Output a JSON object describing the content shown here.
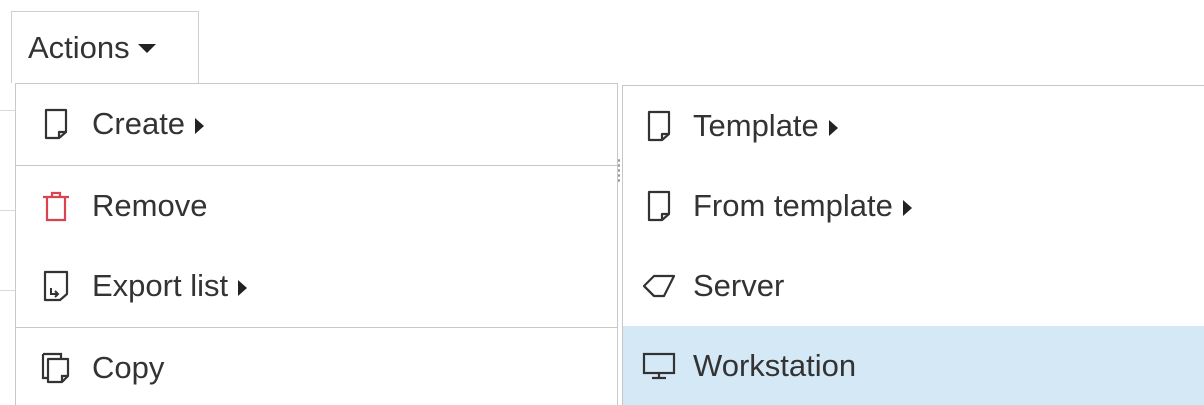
{
  "actions_button": {
    "label": "Actions"
  },
  "menu": {
    "items": [
      {
        "label": "Create",
        "icon": "document-icon",
        "has_submenu": true
      },
      {
        "label": "Remove",
        "icon": "trash-icon",
        "has_submenu": false,
        "icon_color": "#d9434f"
      },
      {
        "label": "Export list",
        "icon": "export-icon",
        "has_submenu": true
      },
      {
        "label": "Copy",
        "icon": "copy-icon",
        "has_submenu": false
      }
    ]
  },
  "submenu": {
    "items": [
      {
        "label": "Template",
        "icon": "document-icon",
        "has_submenu": true
      },
      {
        "label": "From template",
        "icon": "document-icon",
        "has_submenu": true
      },
      {
        "label": "Server",
        "icon": "server-icon",
        "has_submenu": false
      },
      {
        "label": "Workstation",
        "icon": "monitor-icon",
        "has_submenu": false,
        "highlighted": true
      }
    ],
    "highlight_color": "#d4e8f5"
  }
}
